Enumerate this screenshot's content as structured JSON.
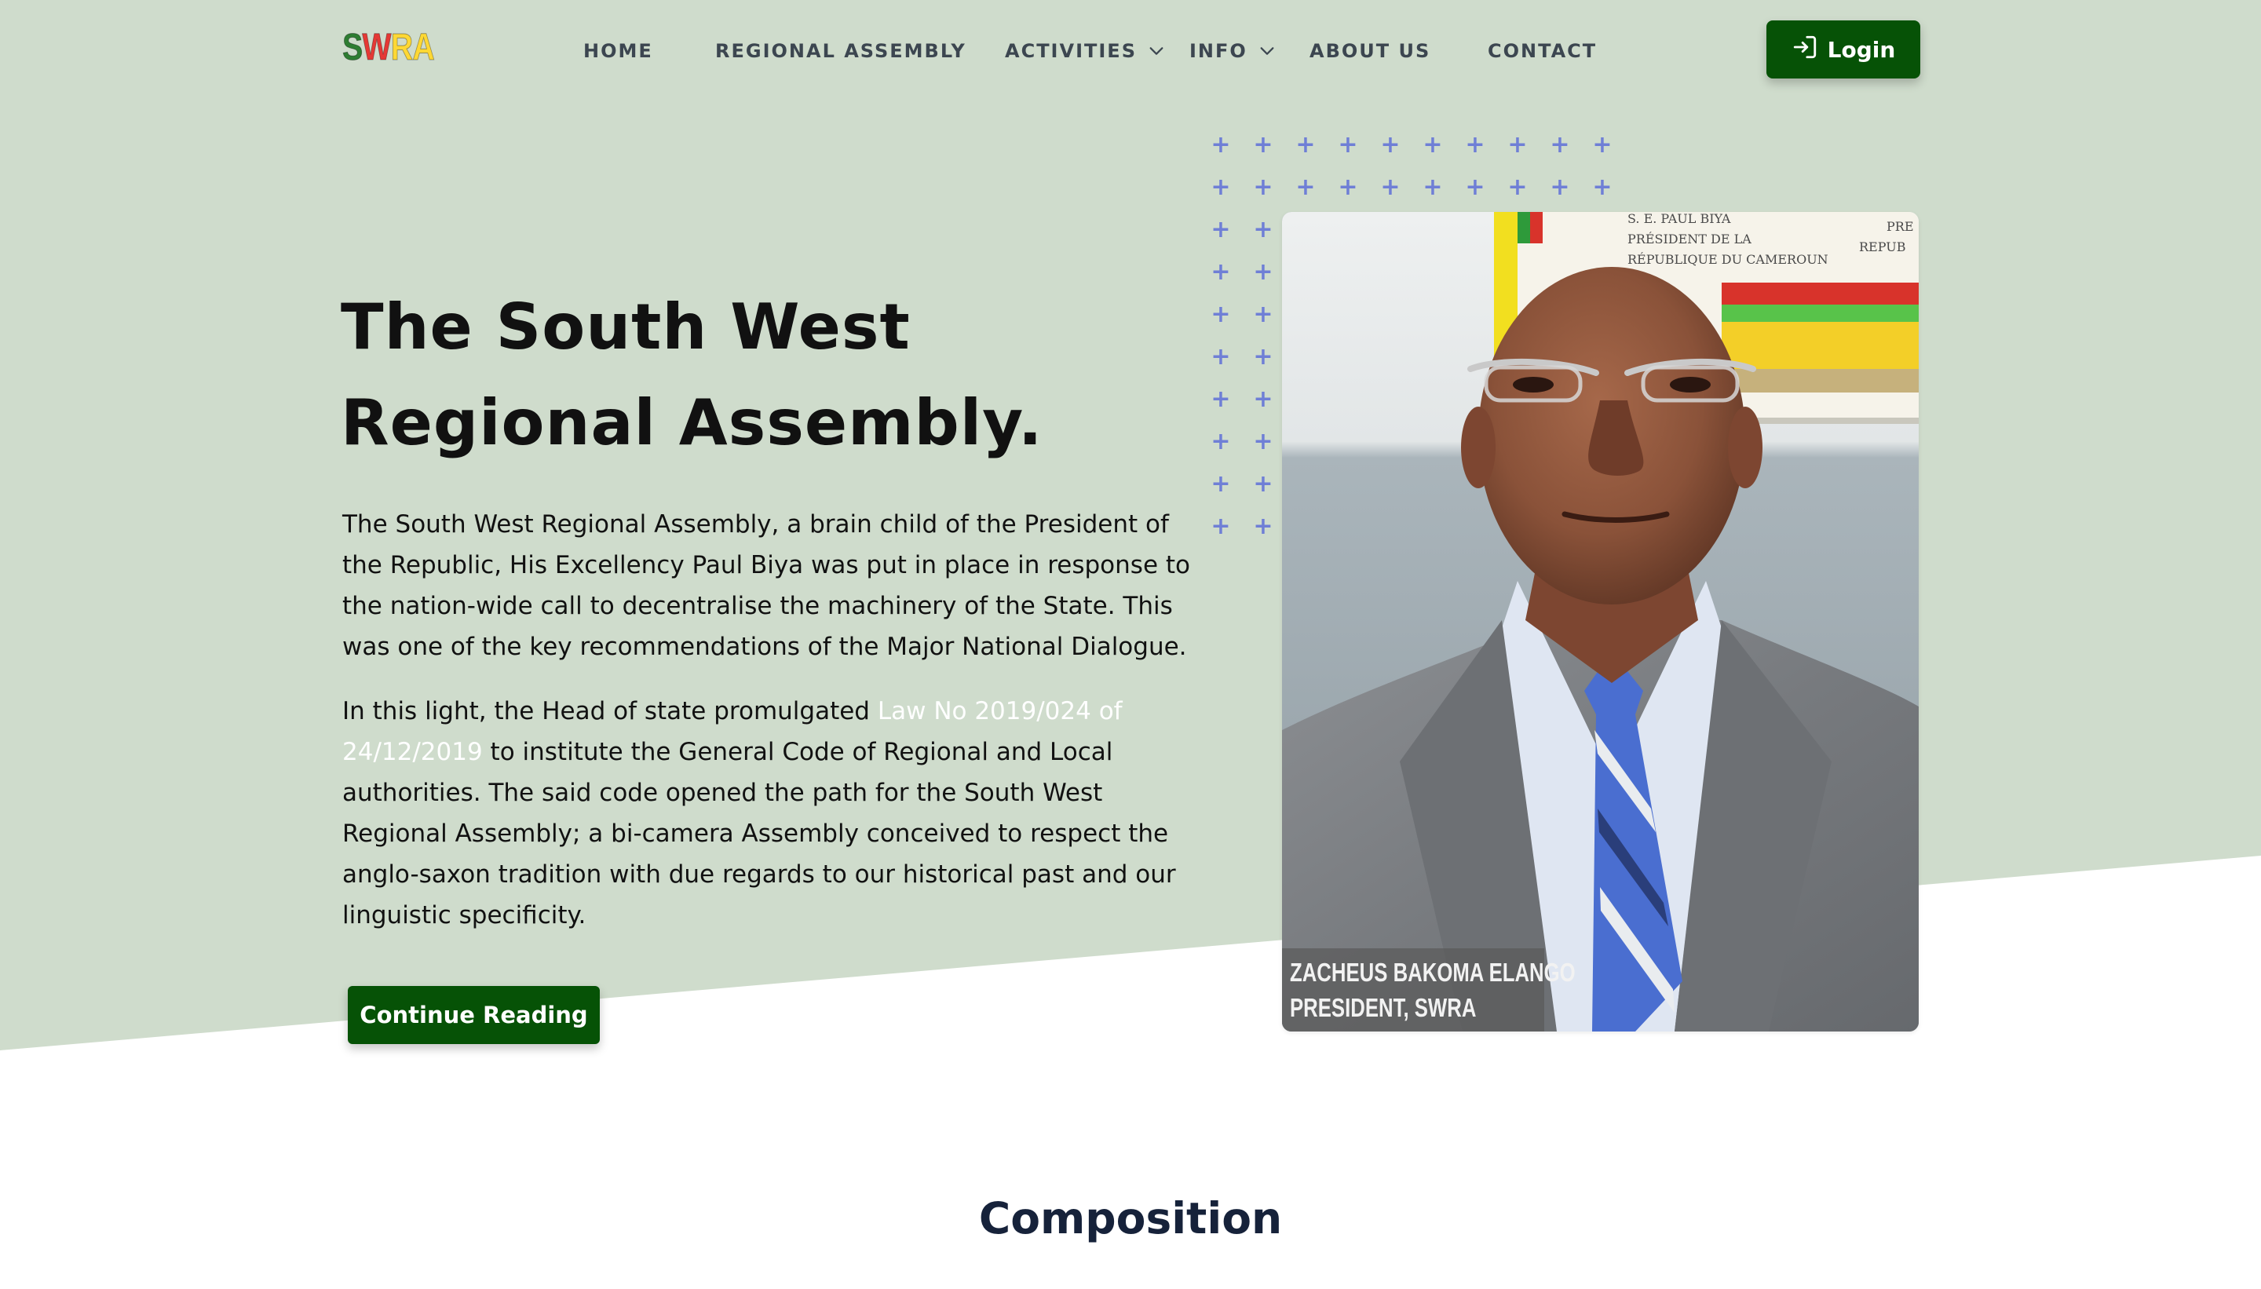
{
  "nav": {
    "logo": [
      "S",
      "W",
      "R",
      "A"
    ],
    "items": [
      {
        "label": "HOME"
      },
      {
        "label": "REGIONAL ASSEMBLY"
      },
      {
        "label": "ACTIVITIES",
        "dropdown": true
      },
      {
        "label": "INFO",
        "dropdown": true
      },
      {
        "label": "ABOUT US"
      },
      {
        "label": "CONTACT"
      }
    ],
    "login_label": "Login",
    "login_icon": "login-icon"
  },
  "hero": {
    "title_line1": "The South West",
    "title_line2": "Regional Assembly.",
    "paragraph1": "The South West Regional Assembly, a brain child of the President of the Republic, His Excellency Paul Biya was put in place in response to the nation-wide call to decentralise the machinery of the State. This was one of the key recommendations of the Major National Dialogue.",
    "paragraph2_prefix": "In this light, the Head of state promulgated ",
    "law_link": "Law No 2019/024 of 24/12/2019",
    "paragraph2_suffix": " to institute the General Code of Regional and Local authorities. The said code opened the path for the South West Regional Assembly; a bi-camera Assembly conceived to respect the anglo-saxon tradition with due regards to our historical past and our linguistic specificity.",
    "cta_label": "Continue Reading"
  },
  "portrait": {
    "caption_line1": "ZACHEUS BAKOMA ELANGO",
    "caption_line2": "PRESIDENT,  SWRA",
    "background_sign": [
      "S. E. PAUL BIYA",
      "PRÉSIDENT DE LA",
      "RÉPUBLIQUE DU CAMEROUN",
      "PRE",
      "REPUB"
    ]
  },
  "sections": {
    "composition_title": "Composition"
  },
  "colors": {
    "hero_bg": "#cfdccc",
    "primary_green": "#065206",
    "plus_blue": "#6f7fd6",
    "heading_navy": "#16223a"
  }
}
